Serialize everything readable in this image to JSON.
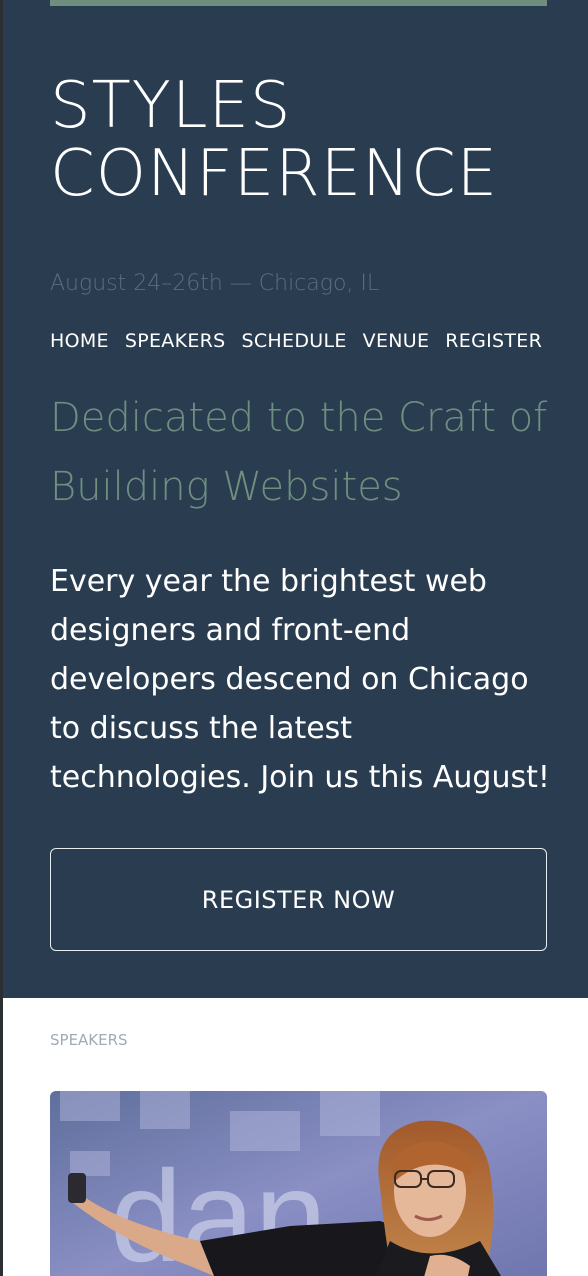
{
  "header": {
    "title_line1": "STYLES",
    "title_line2": "CONFERENCE",
    "dates": "August 24–26th — Chicago, IL"
  },
  "nav": {
    "items": [
      {
        "label": "HOME"
      },
      {
        "label": "SPEAKERS"
      },
      {
        "label": "SCHEDULE"
      },
      {
        "label": "VENUE"
      },
      {
        "label": "REGISTER"
      }
    ]
  },
  "hero": {
    "tagline": "Dedicated to the Craft of Building Websites",
    "intro": "Every year the brightest web designers and front-end developers descend on Chicago to discuss the latest technologies. Join us this August!",
    "cta_label": "REGISTER NOW"
  },
  "speakers": {
    "section_label": "SPEAKERS",
    "photo_icon": "speaker-photo",
    "backdrop_text": "dan"
  },
  "colors": {
    "hero_background": "#2a3d50",
    "accent": "#6e8f80",
    "dates_text": "#5a6e7e",
    "section_label": "#a0aab3"
  }
}
